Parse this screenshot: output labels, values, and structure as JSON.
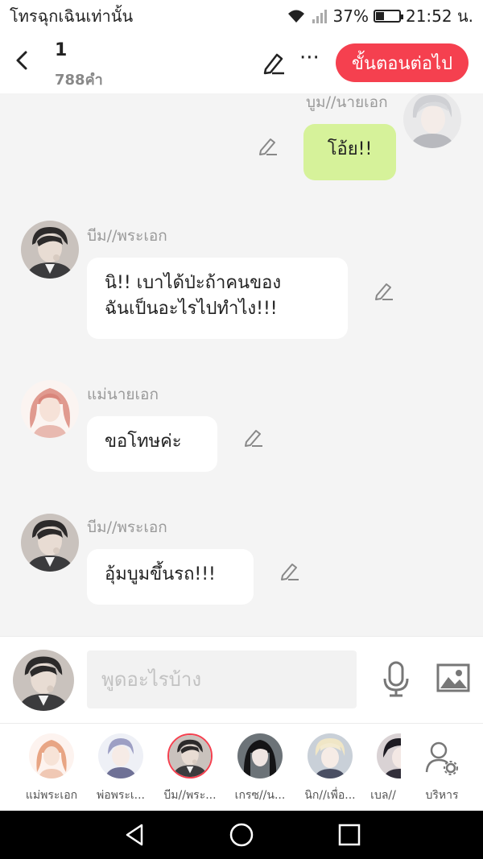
{
  "status": {
    "carrier": "โทรฉุกเฉินเท่านั้น",
    "battery": "37%",
    "battery_level": 0.37,
    "time": "21:52 น."
  },
  "header": {
    "title": "1",
    "word_count": "788คำ",
    "more_label": "···",
    "next_label": "ขั้นตอนต่อไป",
    "accent_color": "#f5404f"
  },
  "messages": [
    {
      "sender": "บูม//นายเอก",
      "text": "โอ้ย!!",
      "side": "right"
    },
    {
      "sender": "บีม//พระเอก",
      "text_line1": "นิ!! เบาได้ป่ะถ้าคนของ",
      "text_line2": "ฉันเป็นอะไรไปทำไง!!!",
      "side": "left"
    },
    {
      "sender": "แม่นายเอก",
      "text": "ขอโทษค่ะ",
      "side": "left"
    },
    {
      "sender": "บีม//พระเอก",
      "text": "อุ้มบูมขึ้นรถ!!!",
      "side": "left"
    }
  ],
  "input": {
    "placeholder": "พูดอะไรบ้าง",
    "mic_icon": "microphone-icon",
    "image_icon": "image-icon"
  },
  "characters": [
    {
      "name": "แม่พระเอก",
      "selected": false
    },
    {
      "name": "พ่อพระเ...",
      "selected": false
    },
    {
      "name": "บีม//พระ...",
      "selected": true
    },
    {
      "name": "เกรซ//น...",
      "selected": false
    },
    {
      "name": "นิก//เพื่อ...",
      "selected": false
    },
    {
      "name": "เบล//",
      "selected": false
    }
  ],
  "manage_label": "บริหาร",
  "colors": {
    "my_bubble": "#d6f29a",
    "other_bubble": "#ffffff",
    "background": "#f4f4f4"
  }
}
